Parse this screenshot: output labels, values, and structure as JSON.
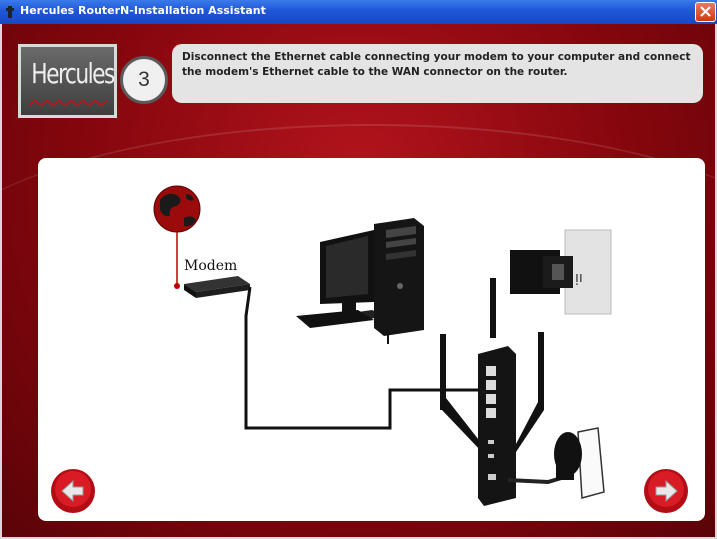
{
  "window": {
    "title": "Hercules RouterN-Installation Assistant"
  },
  "header": {
    "logo_text": "Hercules",
    "step_number": "3",
    "instruction": "Disconnect the Ethernet cable connecting your modem to your computer and connect the modem's Ethernet cable to the WAN connector on the router."
  },
  "illustration": {
    "modem_label": "Modem"
  },
  "colors": {
    "titlebar": "#1f56d8",
    "background_red": "#85060d",
    "panel": "#ffffff",
    "nav_button_red": "#c8101b"
  },
  "icons": {
    "prev": "left-arrow-icon",
    "next": "right-arrow-icon",
    "close": "close-icon"
  }
}
